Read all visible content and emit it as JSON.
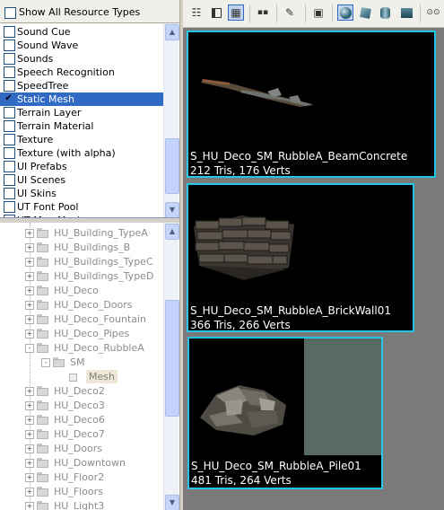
{
  "filter": {
    "show_all_label": "Show All Resource Types",
    "show_all_checked": false
  },
  "resource_types": [
    {
      "label": "Sound Cue",
      "checked": false,
      "selected": false
    },
    {
      "label": "Sound Wave",
      "checked": false,
      "selected": false
    },
    {
      "label": "Sounds",
      "checked": false,
      "selected": false
    },
    {
      "label": "Speech Recognition",
      "checked": false,
      "selected": false
    },
    {
      "label": "SpeedTree",
      "checked": false,
      "selected": false
    },
    {
      "label": "Static Mesh",
      "checked": true,
      "selected": true
    },
    {
      "label": "Terrain Layer",
      "checked": false,
      "selected": false
    },
    {
      "label": "Terrain Material",
      "checked": false,
      "selected": false
    },
    {
      "label": "Texture",
      "checked": false,
      "selected": false
    },
    {
      "label": "Texture (with alpha)",
      "checked": false,
      "selected": false
    },
    {
      "label": "UI Prefabs",
      "checked": false,
      "selected": false
    },
    {
      "label": "UI Scenes",
      "checked": false,
      "selected": false
    },
    {
      "label": "UI Skins",
      "checked": false,
      "selected": false
    },
    {
      "label": "UT Font Pool",
      "checked": false,
      "selected": false
    },
    {
      "label": "UT Map Music",
      "checked": false,
      "selected": false
    }
  ],
  "tree": [
    {
      "label": "HU_Building_TypeA",
      "level": 0,
      "expander": "+"
    },
    {
      "label": "HU_Buildings_B",
      "level": 0,
      "expander": "+"
    },
    {
      "label": "HU_Buildings_TypeC",
      "level": 0,
      "expander": "+"
    },
    {
      "label": "HU_Buildings_TypeD",
      "level": 0,
      "expander": "+"
    },
    {
      "label": "HU_Deco",
      "level": 0,
      "expander": "+"
    },
    {
      "label": "HU_Deco_Doors",
      "level": 0,
      "expander": "+"
    },
    {
      "label": "HU_Deco_Fountain",
      "level": 0,
      "expander": "+"
    },
    {
      "label": "HU_Deco_Pipes",
      "level": 0,
      "expander": "+"
    },
    {
      "label": "HU_Deco_RubbleA",
      "level": 0,
      "expander": "-"
    },
    {
      "label": "SM",
      "level": 1,
      "expander": "-"
    },
    {
      "label": "Mesh",
      "level": 2,
      "expander": "",
      "selected": true
    },
    {
      "label": "HU_Deco2",
      "level": 0,
      "expander": "+"
    },
    {
      "label": "HU_Deco3",
      "level": 0,
      "expander": "+"
    },
    {
      "label": "HU_Deco6",
      "level": 0,
      "expander": "+"
    },
    {
      "label": "HU_Deco7",
      "level": 0,
      "expander": "+"
    },
    {
      "label": "HU_Doors",
      "level": 0,
      "expander": "+"
    },
    {
      "label": "HU_Downtown",
      "level": 0,
      "expander": "+"
    },
    {
      "label": "HU_Floor2",
      "level": 0,
      "expander": "+"
    },
    {
      "label": "HU_Floors",
      "level": 0,
      "expander": "+"
    },
    {
      "label": "HU_Light3",
      "level": 0,
      "expander": "+"
    }
  ],
  "toolbar": {
    "buttons": [
      {
        "name": "list-view-icon",
        "glyph": "☷",
        "active": false
      },
      {
        "name": "split-view-icon",
        "glyph": "",
        "active": false
      },
      {
        "name": "grid-view-icon",
        "glyph": "▦",
        "active": true
      },
      {
        "name": "filmstrip-icon",
        "glyph": "▪▪",
        "active": false
      },
      {
        "name": "eyedropper-icon",
        "glyph": "✎",
        "active": false
      },
      {
        "name": "zoom-fit-icon",
        "glyph": "▣",
        "active": false
      },
      {
        "name": "preview-sphere-icon",
        "shape": "ball",
        "active": true
      },
      {
        "name": "preview-cube-icon",
        "shape": "cube",
        "active": false
      },
      {
        "name": "preview-cylinder-icon",
        "shape": "cyl",
        "active": false
      },
      {
        "name": "preview-plane-icon",
        "shape": "plane",
        "active": false
      },
      {
        "name": "binoculars-icon",
        "glyph": "⊙⊙",
        "active": false
      }
    ]
  },
  "assets": [
    {
      "name": "S_HU_Deco_SM_RubbleA_BeamConcrete",
      "stats": "212 Tris, 176 Verts",
      "preview": "beam-concrete-preview"
    },
    {
      "name": "S_HU_Deco_SM_RubbleA_BrickWall01",
      "stats": "366 Tris, 266 Verts",
      "preview": "brick-wall-preview"
    },
    {
      "name": "S_HU_Deco_SM_RubbleA_Pile01",
      "stats": "481 Tris, 264 Verts",
      "preview": "rubble-pile-preview"
    }
  ],
  "colors": {
    "selection": "#316ac5",
    "card_border": "#27c6e6",
    "gallery_bg": "#7a7a7a"
  }
}
